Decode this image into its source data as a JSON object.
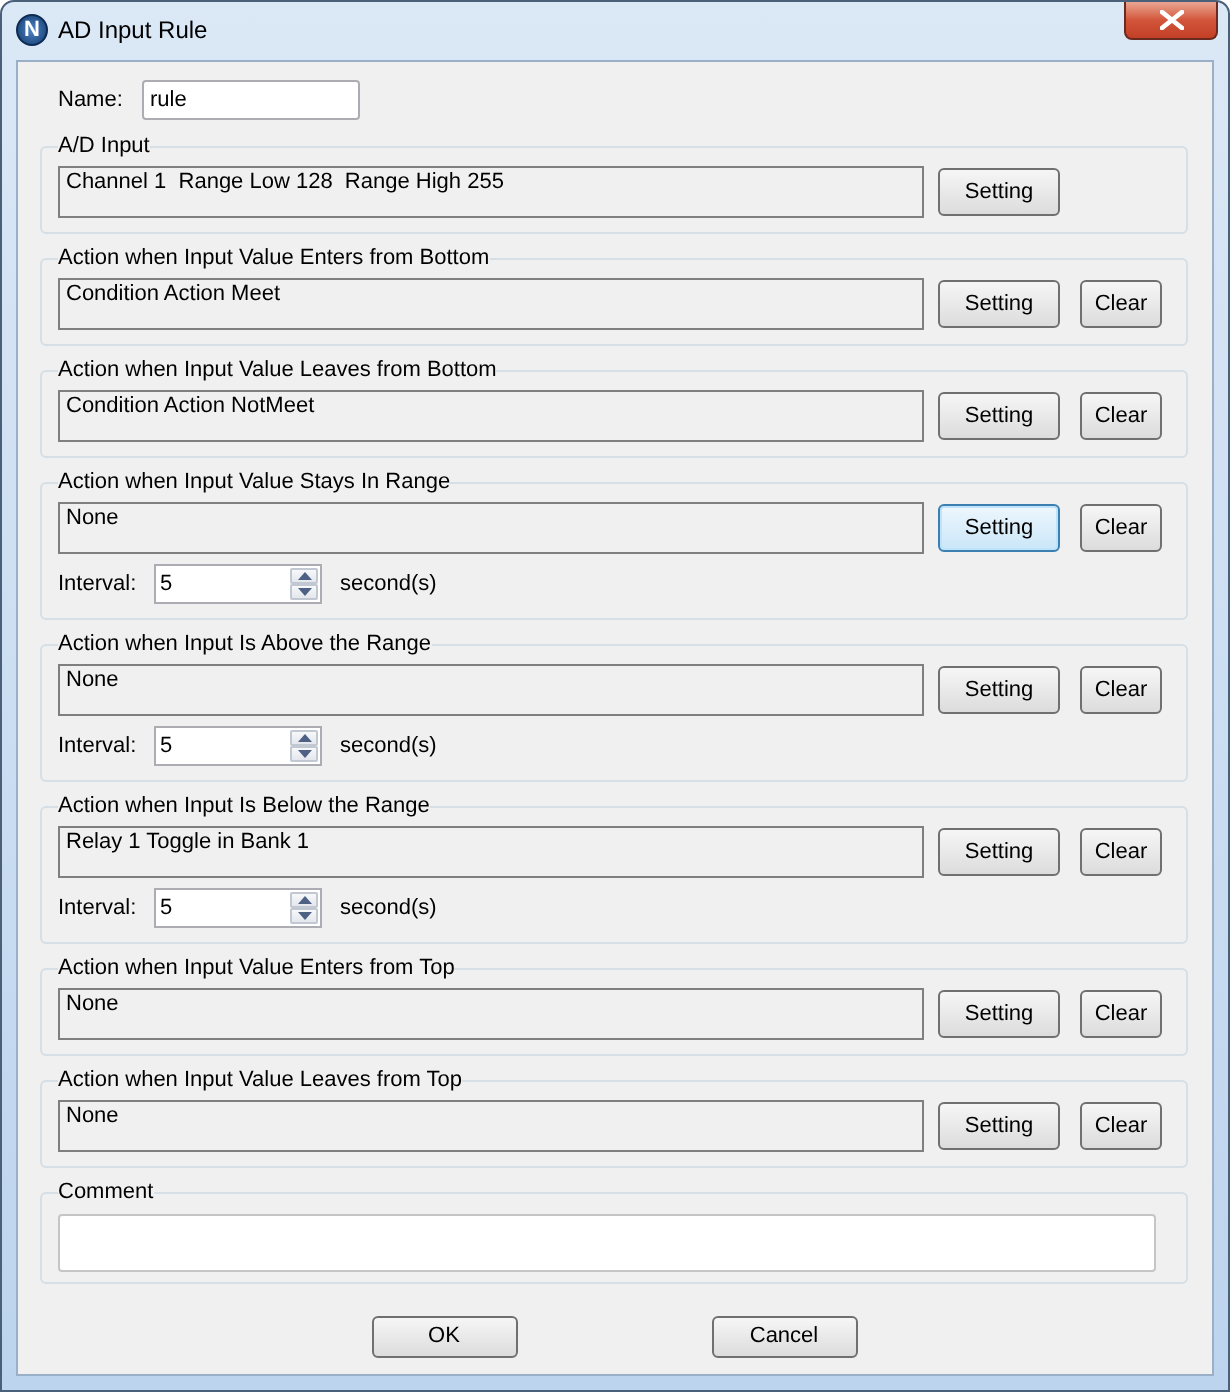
{
  "window": {
    "title": "AD Input Rule",
    "logo_letter": "N"
  },
  "name_field": {
    "label": "Name:",
    "value": "rule"
  },
  "sections": [
    {
      "title": "A/D Input",
      "display": "Channel 1  Range Low 128  Range High 255",
      "buttons": [
        {
          "kind": "setting",
          "label": "Setting",
          "focused": false
        }
      ]
    },
    {
      "title": "Action when Input Value Enters from Bottom",
      "display": "Condition Action Meet",
      "buttons": [
        {
          "kind": "setting",
          "label": "Setting",
          "focused": false
        },
        {
          "kind": "clear",
          "label": "Clear",
          "focused": false
        }
      ]
    },
    {
      "title": "Action when Input Value Leaves from Bottom",
      "display": "Condition Action NotMeet",
      "buttons": [
        {
          "kind": "setting",
          "label": "Setting",
          "focused": false
        },
        {
          "kind": "clear",
          "label": "Clear",
          "focused": false
        }
      ]
    },
    {
      "title": "Action when Input Value Stays In Range",
      "display": "None",
      "buttons": [
        {
          "kind": "setting",
          "label": "Setting",
          "focused": true
        },
        {
          "kind": "clear",
          "label": "Clear",
          "focused": false
        }
      ],
      "interval": {
        "label": "Interval:",
        "value": "5",
        "unit": "second(s)"
      }
    },
    {
      "title": "Action when Input Is Above the Range",
      "display": "None",
      "buttons": [
        {
          "kind": "setting",
          "label": "Setting",
          "focused": false
        },
        {
          "kind": "clear",
          "label": "Clear",
          "focused": false
        }
      ],
      "interval": {
        "label": "Interval:",
        "value": "5",
        "unit": "second(s)"
      }
    },
    {
      "title": "Action when Input Is Below the Range",
      "display": "Relay 1 Toggle in Bank 1",
      "buttons": [
        {
          "kind": "setting",
          "label": "Setting",
          "focused": false
        },
        {
          "kind": "clear",
          "label": "Clear",
          "focused": false
        }
      ],
      "interval": {
        "label": "Interval:",
        "value": "5",
        "unit": "second(s)"
      }
    },
    {
      "title": "Action when Input Value Enters from Top",
      "display": "None",
      "buttons": [
        {
          "kind": "setting",
          "label": "Setting",
          "focused": false
        },
        {
          "kind": "clear",
          "label": "Clear",
          "focused": false
        }
      ]
    },
    {
      "title": "Action when Input Value Leaves from Top",
      "display": "None",
      "buttons": [
        {
          "kind": "setting",
          "label": "Setting",
          "focused": false
        },
        {
          "kind": "clear",
          "label": "Clear",
          "focused": false
        }
      ]
    }
  ],
  "comment": {
    "title": "Comment"
  },
  "footer_buttons": [
    {
      "label": "OK"
    },
    {
      "label": "Cancel"
    }
  ]
}
